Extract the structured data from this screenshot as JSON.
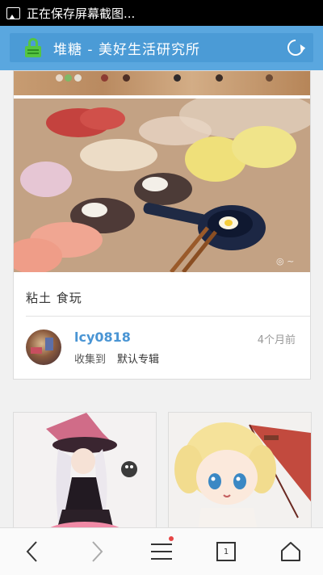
{
  "status_bar": {
    "text": "正在保存屏幕截图..."
  },
  "address_bar": {
    "title": "堆糖 - 美好生活研究所"
  },
  "feed": {
    "cards": [
      {
        "tags": "粘土 食玩",
        "user": {
          "name": "lcy0818",
          "time": "4个月前"
        },
        "collected_prefix": "收集到",
        "album": "默认专辑"
      }
    ]
  },
  "bottom_nav": {
    "tab_count": "1"
  }
}
